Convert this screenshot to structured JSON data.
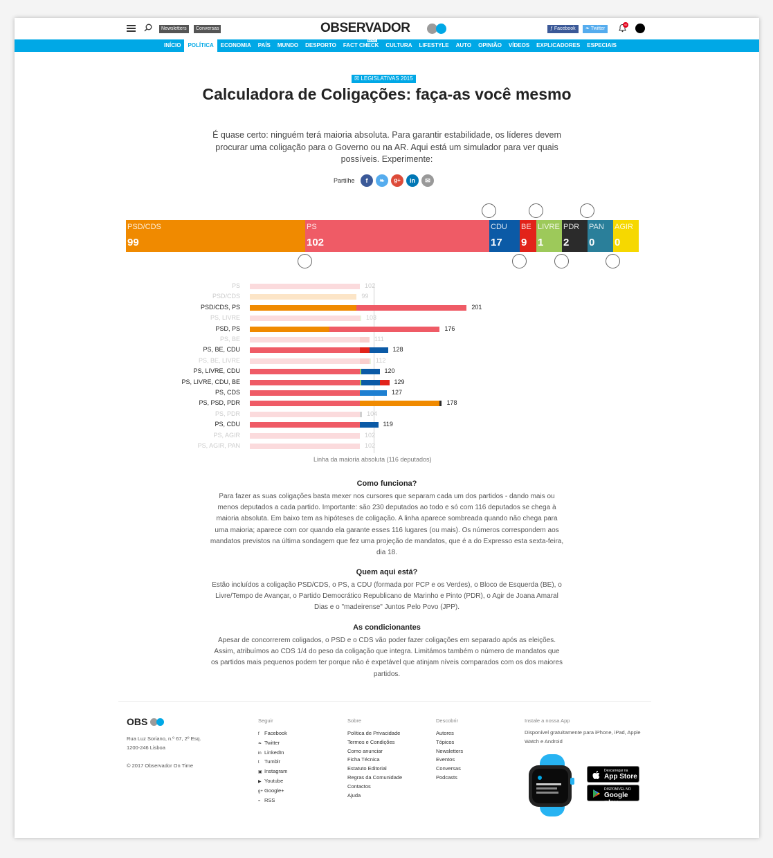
{
  "header": {
    "newsletters": "Newsletters",
    "conversas": "Conversas",
    "logo": "OBSERVADOR",
    "facebook": "Facebook",
    "twitter": "Twitter",
    "notifications": "40"
  },
  "nav": [
    "INÍCIO",
    "POLÍTICA",
    "ECONOMIA",
    "PAÍS",
    "MUNDO",
    "DESPORTO",
    "FACT CHECK",
    "CULTURA",
    "LIFESTYLE",
    "AUTO",
    "OPINIÃO",
    "VÍDEOS",
    "EXPLICADORES",
    "ESPECIAIS"
  ],
  "nav_new_badge": "NOVO",
  "article": {
    "tag": "LEGISLATIVAS 2015",
    "title": "Calculadora de Coligações: faça-as você mesmo",
    "lead": "É quase certo: ninguém terá maioria absoluta. Para garantir estabilidade, os líderes devem procurar uma coligação para o Governo ou na AR. Aqui está um simulador para ver quais possíveis. Experimente:",
    "share_label": "Partilhe"
  },
  "chart_data": {
    "type": "bar",
    "parties": [
      {
        "name": "PSD/CDS",
        "seats": 99,
        "color": "#f08a00"
      },
      {
        "name": "PS",
        "seats": 102,
        "color": "#ef5b66"
      },
      {
        "name": "CDU",
        "seats": 17,
        "color": "#0b5aa6"
      },
      {
        "name": "BE",
        "seats": 9,
        "color": "#e2231a"
      },
      {
        "name": "LIVRE",
        "seats": 1,
        "color": "#9dc95a"
      },
      {
        "name": "PDR",
        "seats": 2,
        "color": "#2b2b2b"
      },
      {
        "name": "PAN",
        "seats": 0,
        "color": "#2a7f9a"
      },
      {
        "name": "AGIR",
        "seats": 0,
        "color": "#f6d800"
      }
    ],
    "coalitions": [
      {
        "label": "PS",
        "total": "102",
        "majority": false,
        "segments": [
          {
            "party": "PS",
            "seats": 102
          }
        ]
      },
      {
        "label": "PSD/CDS",
        "total": "99",
        "majority": false,
        "segments": [
          {
            "party": "PSD/CDS",
            "seats": 99
          }
        ]
      },
      {
        "label": "PSD/CDS, PS",
        "total": "201",
        "majority": true,
        "segments": [
          {
            "party": "PSD/CDS",
            "seats": 99
          },
          {
            "party": "PS",
            "seats": 102
          }
        ]
      },
      {
        "label": "PS, LIVRE",
        "total": "103",
        "majority": false,
        "segments": [
          {
            "party": "PS",
            "seats": 102
          },
          {
            "party": "LIVRE",
            "seats": 1
          }
        ]
      },
      {
        "label": "PSD, PS",
        "total": "176",
        "majority": true,
        "segments": [
          {
            "party": "PSD/CDS",
            "seats": 74
          },
          {
            "party": "PS",
            "seats": 102
          }
        ]
      },
      {
        "label": "PS, BE",
        "total": "111",
        "majority": false,
        "segments": [
          {
            "party": "PS",
            "seats": 102
          },
          {
            "party": "BE",
            "seats": 9
          }
        ]
      },
      {
        "label": "PS, BE, CDU",
        "total": "128",
        "majority": true,
        "segments": [
          {
            "party": "PS",
            "seats": 102
          },
          {
            "party": "BE",
            "seats": 9
          },
          {
            "party": "CDU",
            "seats": 17
          }
        ]
      },
      {
        "label": "PS, BE, LIVRE",
        "total": "112",
        "majority": false,
        "segments": [
          {
            "party": "PS",
            "seats": 102
          },
          {
            "party": "BE",
            "seats": 9
          },
          {
            "party": "LIVRE",
            "seats": 1
          }
        ]
      },
      {
        "label": "PS, LIVRE, CDU",
        "total": "120",
        "majority": true,
        "segments": [
          {
            "party": "PS",
            "seats": 102
          },
          {
            "party": "LIVRE",
            "seats": 1
          },
          {
            "party": "CDU",
            "seats": 17
          }
        ]
      },
      {
        "label": "PS, LIVRE, CDU, BE",
        "total": "129",
        "majority": true,
        "segments": [
          {
            "party": "PS",
            "seats": 102
          },
          {
            "party": "LIVRE",
            "seats": 1
          },
          {
            "party": "CDU",
            "seats": 17
          },
          {
            "party": "BE",
            "seats": 9
          }
        ]
      },
      {
        "label": "PS, CDS",
        "total": "127",
        "majority": true,
        "segments": [
          {
            "party": "PS",
            "seats": 102
          },
          {
            "party": "CDS",
            "seats": 25
          }
        ]
      },
      {
        "label": "PS, PSD, PDR",
        "total": "178",
        "majority": true,
        "segments": [
          {
            "party": "PS",
            "seats": 102
          },
          {
            "party": "PSD/CDS",
            "seats": 74
          },
          {
            "party": "PDR",
            "seats": 2
          }
        ]
      },
      {
        "label": "PS, PDR",
        "total": "104",
        "majority": false,
        "segments": [
          {
            "party": "PS",
            "seats": 102
          },
          {
            "party": "PDR",
            "seats": 2
          }
        ]
      },
      {
        "label": "PS, CDU",
        "total": "119",
        "majority": true,
        "segments": [
          {
            "party": "PS",
            "seats": 102
          },
          {
            "party": "CDU",
            "seats": 17
          }
        ]
      },
      {
        "label": "PS, AGIR",
        "total": "102",
        "majority": false,
        "segments": [
          {
            "party": "PS",
            "seats": 102
          }
        ]
      },
      {
        "label": "PS, AGIR, PAN",
        "total": "102",
        "majority": false,
        "segments": [
          {
            "party": "PS",
            "seats": 102
          }
        ]
      }
    ],
    "majority_threshold": 116,
    "majority_caption": "Linha da maioria absoluta (116 deputados)"
  },
  "sections": [
    {
      "title": "Como funciona?",
      "text": "Para fazer as suas coligações basta mexer nos cursores que separam cada um dos partidos - dando mais ou menos deputados a cada partido. Importante: são 230 deputados ao todo e só com 116 deputados se chega à maioria absoluta. Em baixo tem as hipóteses de coligação. A linha aparece sombreada quando não chega para uma maioria; aparece com cor quando ela garante esses 116 lugares (ou mais). Os números correspondem aos mandatos previstos na última sondagem que fez uma projeção de mandatos, que é a do Expresso esta sexta-feira, dia 18."
    },
    {
      "title": "Quem aqui está?",
      "text": "Estão incluídos a coligação PSD/CDS, o PS, a CDU (formada por PCP e os Verdes), o Bloco de Esquerda (BE), o Livre/Tempo de Avançar, o Partido Democrático Republicano de Marinho e Pinto (PDR), o Agir de Joana Amaral Dias e o \"madeirense\" Juntos Pelo Povo (JPP)."
    },
    {
      "title": "As condicionantes",
      "text": "Apesar de concorrerem coligados, o PSD e o CDS vão poder fazer coligações em separado após as eleições. Assim, atribuímos ao CDS 1/4 do peso da coligação que integra. Limitámos também o número de mandatos que os partidos mais pequenos podem ter porque não é expetável que atinjam níveis comparados com os dos maiores partidos."
    }
  ],
  "footer": {
    "logo": "OBS",
    "address1": "Rua Luz Soriano, n.º 67, 2º Esq.",
    "address2": "1200-246 Lisboa",
    "copyright": "© 2017 Observador On Time",
    "seguir_title": "Seguir",
    "seguir": [
      "Facebook",
      "Twitter",
      "LinkedIn",
      "Tumblr",
      "Instagram",
      "Youtube",
      "Google+",
      "RSS"
    ],
    "sobre_title": "Sobre",
    "sobre": [
      "Política de Privacidade",
      "Termos e Condições",
      "Como anunciar",
      "Ficha Técnica",
      "Estatuto Editorial",
      "Regras da Comunidade",
      "Contactos",
      "Ajuda"
    ],
    "descobrir_title": "Descobrir",
    "descobrir": [
      "Autores",
      "Tópicos",
      "Newsletters",
      "Eventos",
      "Conversas",
      "Podcasts"
    ],
    "app_title": "Instale a nossa App",
    "app_text": "Disponível gratuitamente para iPhone, iPad, Apple Watch e Android",
    "appstore_small": "Descarregar na",
    "appstore_large": "App Store",
    "googleplay_small": "DISPONÍVEL NO",
    "googleplay_large": "Google play"
  },
  "colors": {
    "accent": "#00a8e6",
    "cds": "#1e7fd1"
  }
}
